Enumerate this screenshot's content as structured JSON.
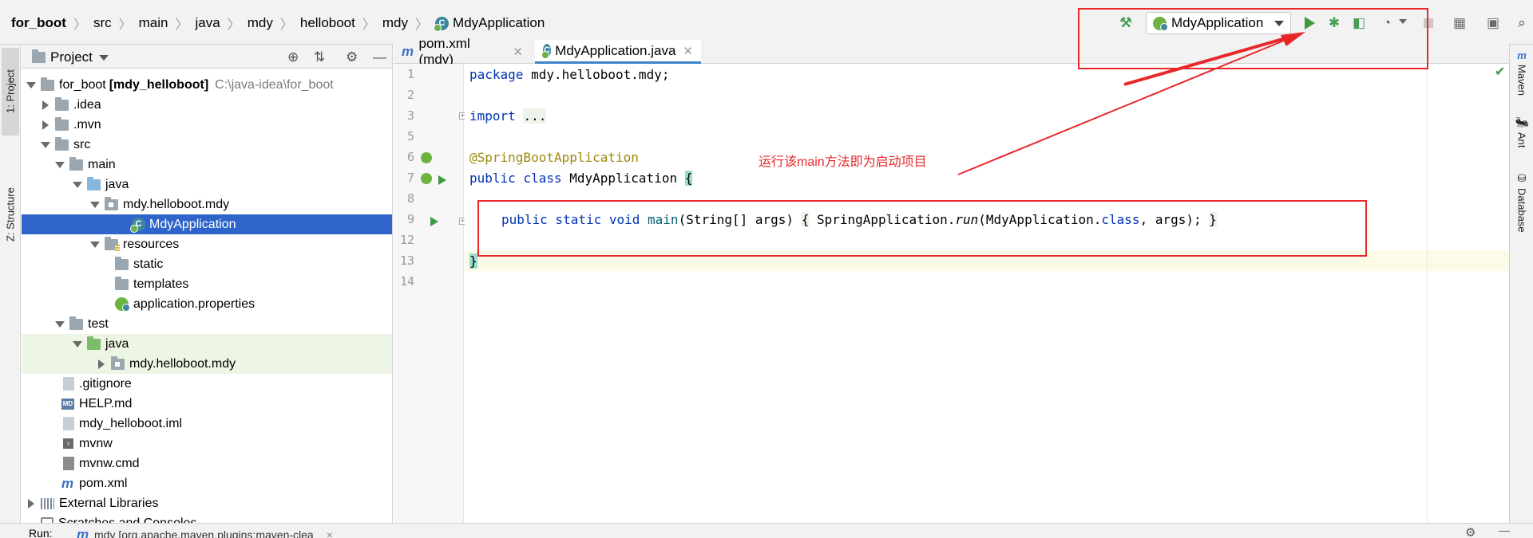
{
  "breadcrumb": [
    "for_boot",
    "src",
    "main",
    "java",
    "mdy",
    "helloboot",
    "mdy",
    "MdyApplication"
  ],
  "toolbar": {
    "run_config": "MdyApplication",
    "icons": [
      "hammer-icon",
      "run-icon",
      "debug-icon",
      "coverage-icon",
      "profile-icon",
      "stop-icon",
      "project-structure-icon",
      "terminal-icon",
      "search-icon"
    ]
  },
  "left_strip": {
    "project_tab": "1: Project",
    "structure_tab": "Z: Structure"
  },
  "right_strip": {
    "maven": "Maven",
    "ant": "Ant",
    "database": "Database"
  },
  "project_panel": {
    "title": "Project",
    "tree": [
      {
        "label": "for_boot",
        "bold": "[mdy_helloboot]",
        "hint": "C:\\java-idea\\for_boot"
      },
      {
        "label": ".idea"
      },
      {
        "label": ".mvn"
      },
      {
        "label": "src"
      },
      {
        "label": "main"
      },
      {
        "label": "java"
      },
      {
        "label": "mdy.helloboot.mdy"
      },
      {
        "label": "MdyApplication"
      },
      {
        "label": "resources"
      },
      {
        "label": "static"
      },
      {
        "label": "templates"
      },
      {
        "label": "application.properties"
      },
      {
        "label": "test"
      },
      {
        "label": "java"
      },
      {
        "label": "mdy.helloboot.mdy"
      },
      {
        "label": ".gitignore"
      },
      {
        "label": "HELP.md"
      },
      {
        "label": "mdy_helloboot.iml"
      },
      {
        "label": "mvnw"
      },
      {
        "label": "mvnw.cmd"
      },
      {
        "label": "pom.xml"
      },
      {
        "label": "External Libraries"
      },
      {
        "label": "Scratches and Consoles"
      }
    ]
  },
  "editor": {
    "tabs": [
      {
        "label": "pom.xml (mdy)",
        "active": false
      },
      {
        "label": "MdyApplication.java",
        "active": true
      }
    ],
    "line_numbers": [
      "1",
      "2",
      "3",
      "5",
      "6",
      "7",
      "8",
      "9",
      "12",
      "13",
      "14"
    ],
    "code": {
      "l1_kw": "package",
      "l1_rest": " mdy.helloboot.mdy;",
      "l3_kw": "import",
      "l3_rest": "...",
      "l6": "@SpringBootApplication",
      "l7_kw": "public class",
      "l7_rest": " MdyApplication ",
      "l7_brace": "{",
      "l9_kw": "public static void",
      "l9_fn": "main",
      "l9_a": "(String[] args) ",
      "l9_b": "{",
      "l9_c": " SpringApplication.",
      "l9_run": "run",
      "l9_d": "(MdyApplication.",
      "l9_class": "class",
      "l9_e": ", args); ",
      "l9_f": "}",
      "l13": "}"
    }
  },
  "annotation": {
    "note": "运行该main方法即为启动项目",
    "color": "#e8272a"
  },
  "bottom_bar": {
    "run_label": "Run:",
    "run_tab": "mdy [org.apache.maven.plugins:maven-clea",
    "close": "×"
  }
}
